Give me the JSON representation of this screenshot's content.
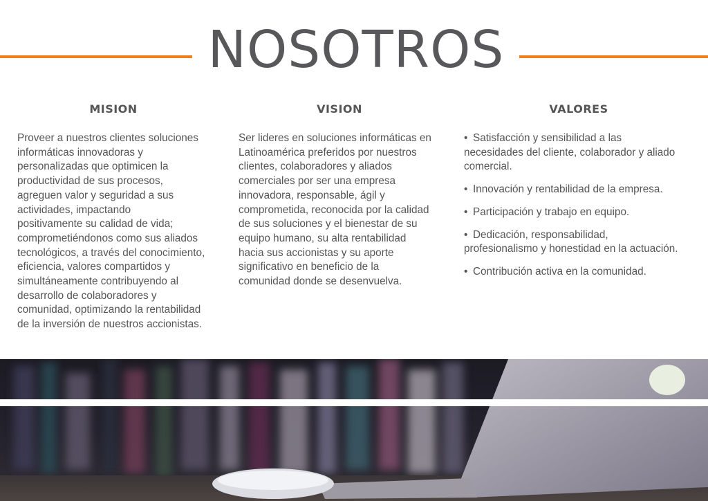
{
  "header": {
    "title": "NOSOTROS",
    "accent_color": "#f07f1a"
  },
  "mision": {
    "heading": "MISION",
    "text": "Proveer a nuestros clientes soluciones\ninformáticas innovadoras y\npersonalizadas que optimicen la\nproductividad de sus procesos,\nagreguen valor y seguridad a sus\nactividades, impactando\npositivamente su calidad de vida;\ncomprometiéndonos como sus aliados\ntecnológicos, a través del conocimiento,\neficiencia, valores  compartidos y\nsimultáneamente contribuyendo al\ndesarrollo de colaboradores y\ncomunidad, optimizando la rentabilidad\nde la inversión de nuestros accionistas."
  },
  "vision": {
    "heading": "VISION",
    "text": "Ser lideres en soluciones informáticas en\nLatinoamérica preferidos por nuestros\nclientes, colaboradores y aliados\ncomerciales por ser una empresa\ninnovadora,  responsable, ágil y\ncomprometida, reconocida por la calidad\nde sus soluciones y el bienestar de su\nequipo humano, su alta rentabilidad\nhacia sus accionistas y su aporte\nsignificativo en beneficio de la\ncomunidad donde se desenvuelva."
  },
  "valores": {
    "heading": "VALORES",
    "bullet": "•",
    "items": [
      "Satisfacción y sensibilidad a las\nnecesidades del cliente, colaborador y aliado\ncomercial.",
      "Innovación y rentabilidad de la empresa.",
      "Participación y trabajo en equipo.",
      "Dedicación, responsabilidad,\nprofesionalismo y honestidad en la actuación.",
      "Contribución activa en la comunidad."
    ]
  }
}
